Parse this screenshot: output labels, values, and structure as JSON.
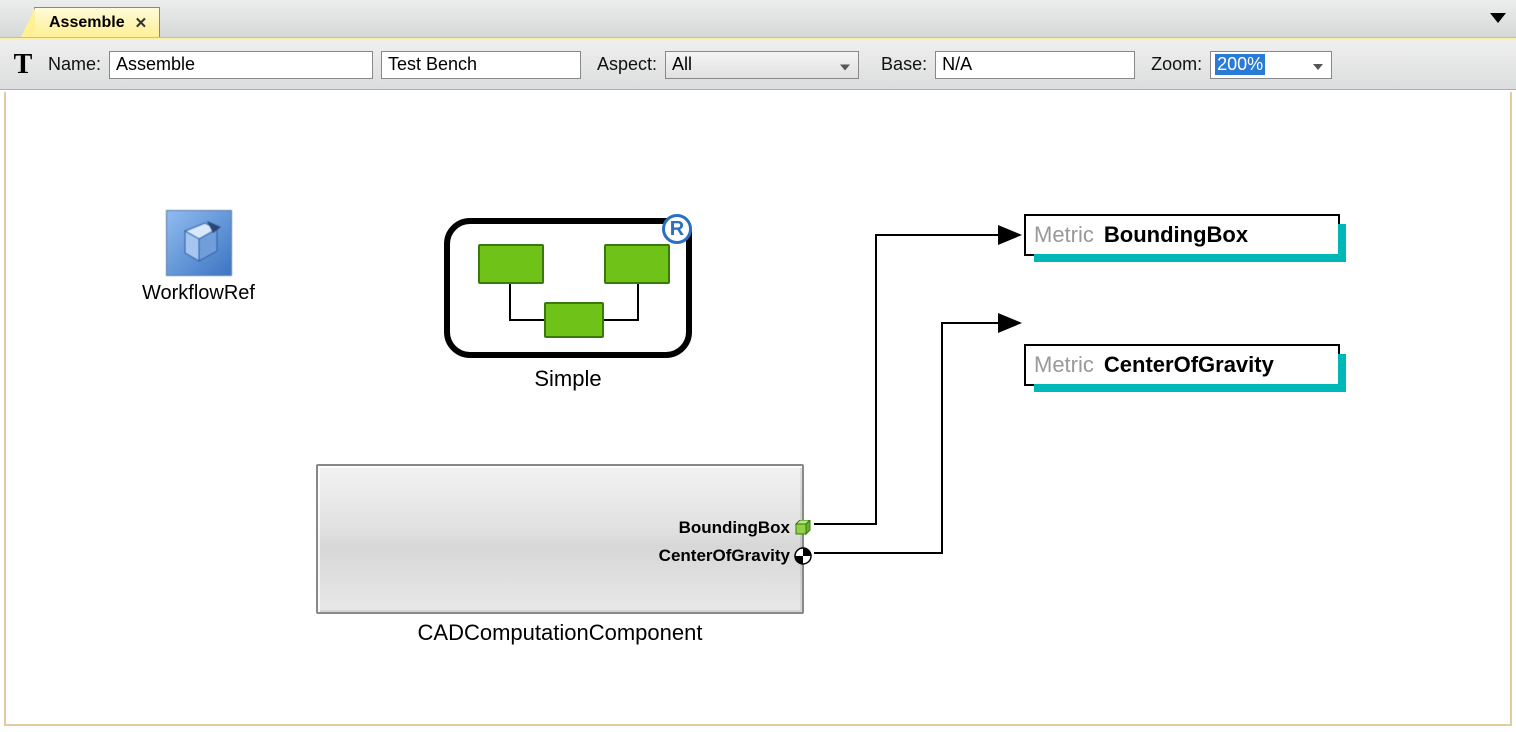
{
  "tab": {
    "title": "Assemble"
  },
  "toolbar": {
    "tool_letter": "T",
    "name_label": "Name:",
    "name_value": "Assemble",
    "kind_value": "Test Bench",
    "aspect_label": "Aspect:",
    "aspect_value": "All",
    "base_label": "Base:",
    "base_value": "N/A",
    "zoom_label": "Zoom:",
    "zoom_value": "200%"
  },
  "nodes": {
    "workflow": {
      "label": "WorkflowRef"
    },
    "simple": {
      "label": "Simple",
      "badge": "R"
    },
    "component": {
      "label": "CADComputationComponent",
      "ports": [
        {
          "name": "BoundingBox"
        },
        {
          "name": "CenterOfGravity"
        }
      ]
    },
    "metrics": [
      {
        "prefix": "Metric",
        "name": "BoundingBox"
      },
      {
        "prefix": "Metric",
        "name": "CenterOfGravity"
      }
    ]
  }
}
